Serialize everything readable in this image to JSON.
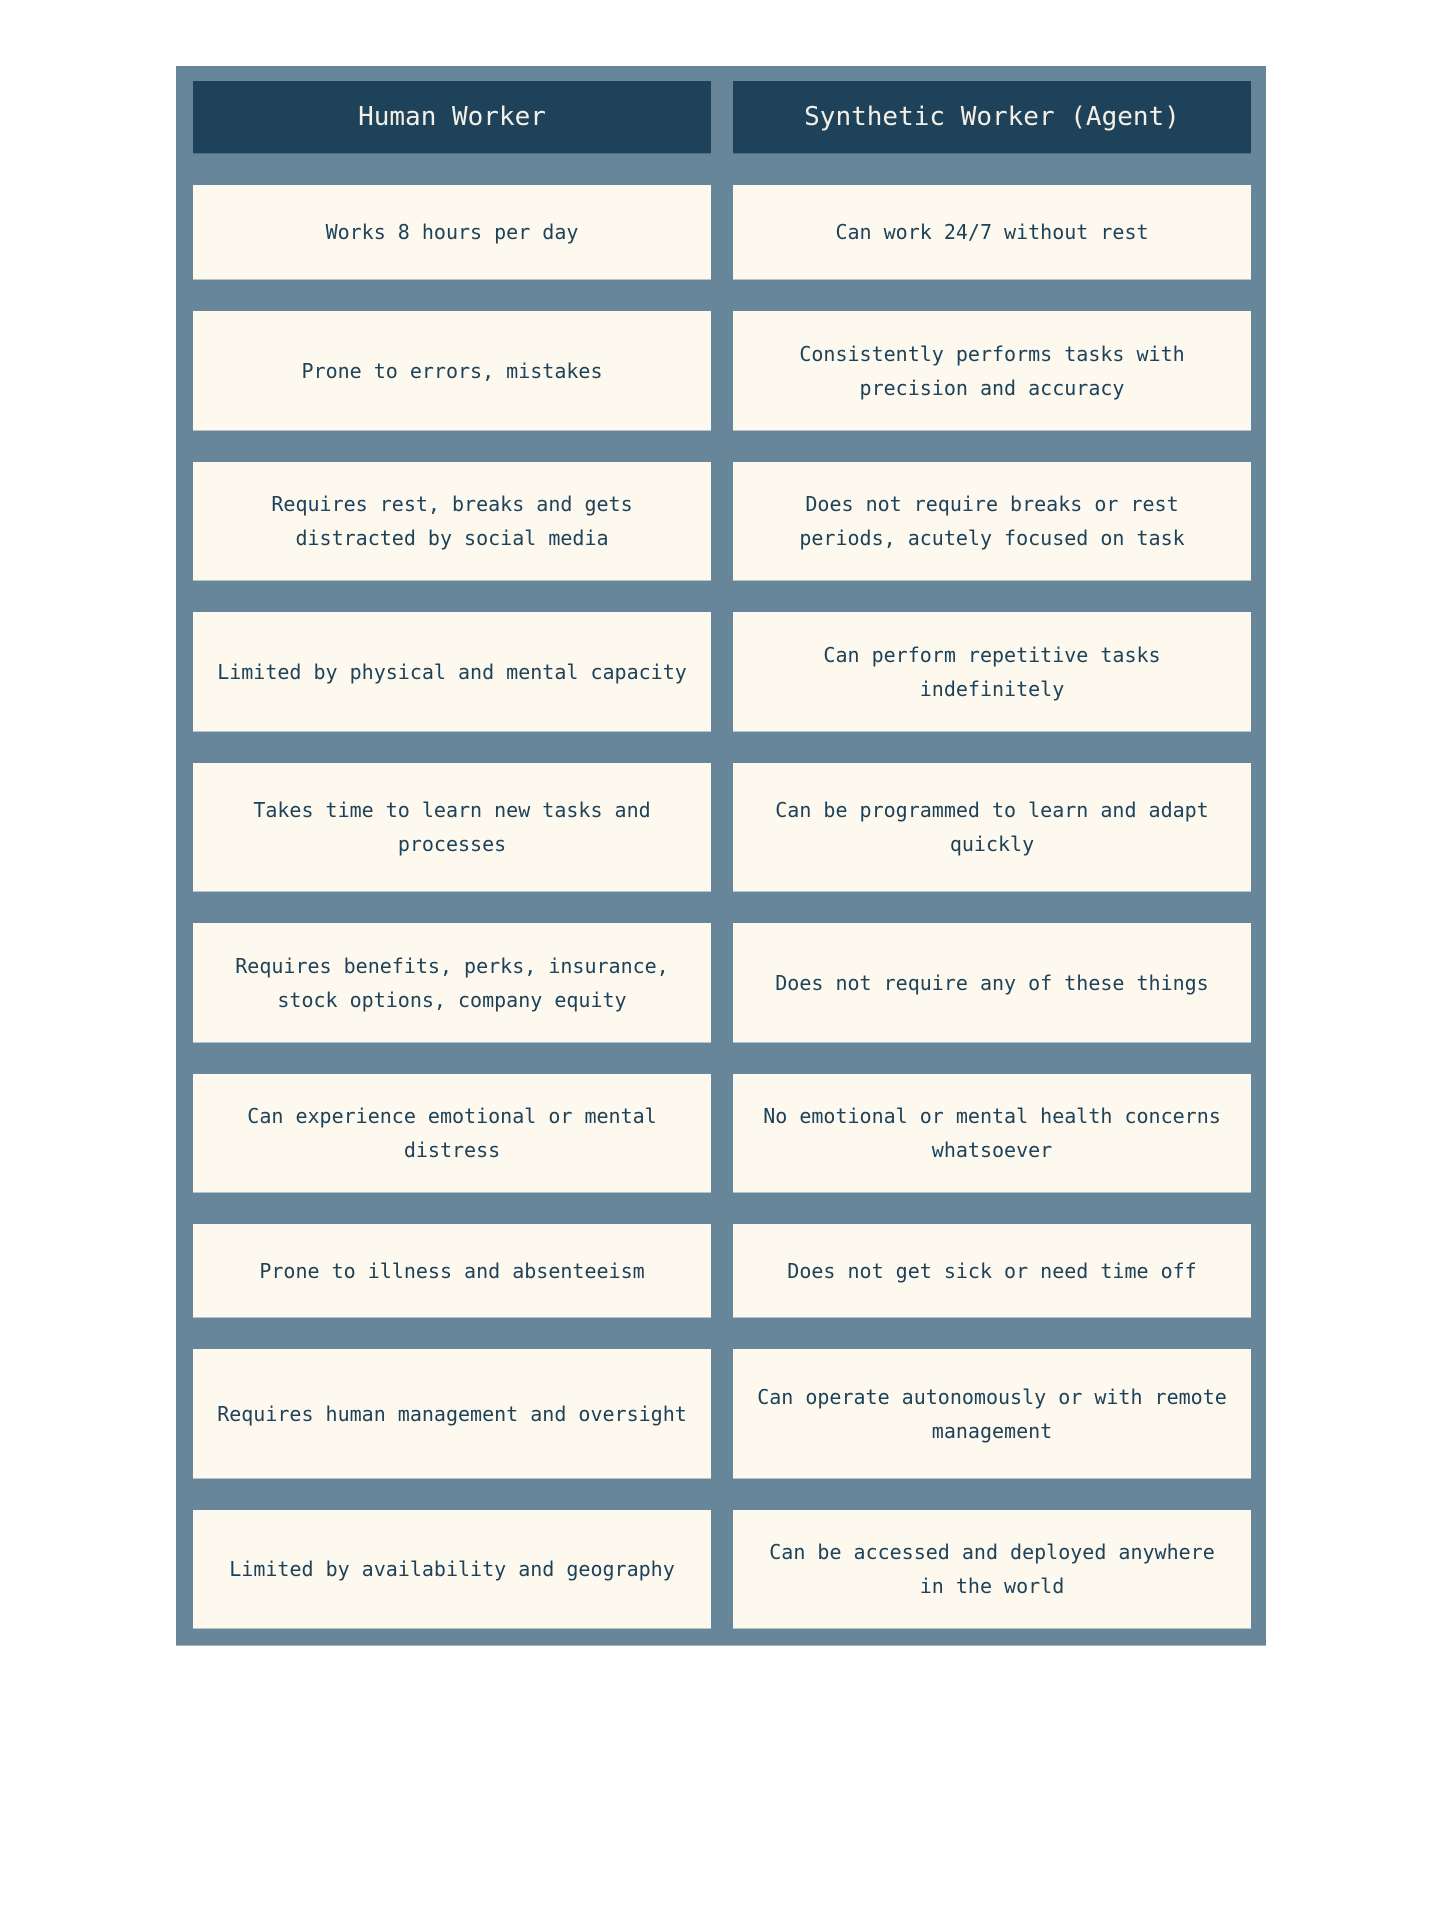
{
  "table": {
    "headers": [
      "Human Worker",
      "Synthetic Worker (Agent)"
    ],
    "rows": [
      {
        "human": "Works 8 hours per day",
        "agent": "Can work 24/7 without rest"
      },
      {
        "human": "Prone to errors, mistakes",
        "agent": "Consistently performs tasks with precision and accuracy"
      },
      {
        "human": "Requires rest, breaks and gets distracted by social media",
        "agent": "Does not require breaks or rest periods, acutely focused on task"
      },
      {
        "human": "Limited by physical and mental capacity",
        "agent": "Can perform repetitive tasks indefinitely"
      },
      {
        "human": "Takes time to learn new tasks and processes",
        "agent": "Can be programmed to learn and adapt quickly"
      },
      {
        "human": "Requires benefits, perks, insurance, stock options, company equity",
        "agent": "Does not require any of these things"
      },
      {
        "human": "Can experience emotional or mental distress",
        "agent": "No emotional or mental health concerns whatsoever"
      },
      {
        "human": "Prone to illness and absenteeism",
        "agent": "Does not get sick or need time off"
      },
      {
        "human": "Requires human management and oversight",
        "agent": "Can operate autonomously or with remote management"
      },
      {
        "human": "Limited by availability and geography",
        "agent": "Can be accessed and deployed anywhere in the world"
      }
    ]
  },
  "colors": {
    "frame": "#68869a",
    "header_bg": "#1e4259",
    "header_text": "#f3efe6",
    "cell_bg": "#fdf9ef",
    "cell_text": "#1e4259"
  }
}
